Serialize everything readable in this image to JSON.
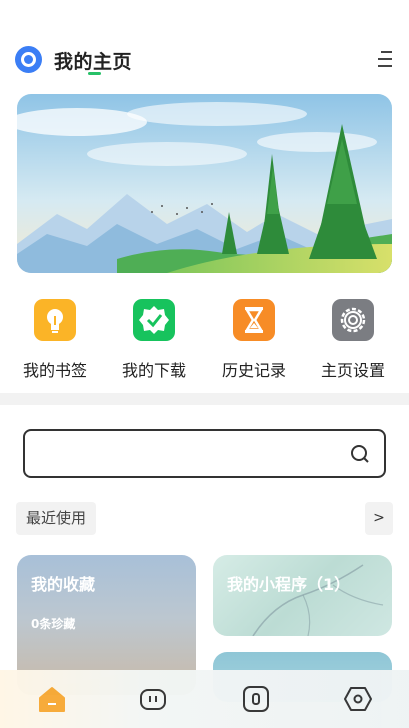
{
  "header": {
    "title": "我的主页",
    "logo_icon": "search-logo-icon",
    "menu_icon": "menu-icon"
  },
  "shortcuts": [
    {
      "label": "我的书签",
      "icon": "lightbulb-icon",
      "color": "#fbb427"
    },
    {
      "label": "我的下载",
      "icon": "verified-badge-icon",
      "color": "#17c35d"
    },
    {
      "label": "历史记录",
      "icon": "hourglass-icon",
      "color": "#f78c26"
    },
    {
      "label": "主页设置",
      "icon": "gear-icon",
      "color": "#7b7d82"
    }
  ],
  "search": {
    "value": "",
    "placeholder": "",
    "icon": "search-icon"
  },
  "recent": {
    "label": "最近使用",
    "more": ">"
  },
  "cards": {
    "favorites": {
      "title": "我的收藏",
      "subtitle": "0条珍藏"
    },
    "mini_programs": {
      "title": "我的小程序（1）"
    }
  },
  "tabbar": [
    {
      "icon": "home-icon",
      "active": true,
      "color": "#f7a935"
    },
    {
      "icon": "robot-face-icon",
      "active": false
    },
    {
      "icon": "zero-box-icon",
      "active": false
    },
    {
      "icon": "hexagon-icon",
      "active": false
    }
  ]
}
